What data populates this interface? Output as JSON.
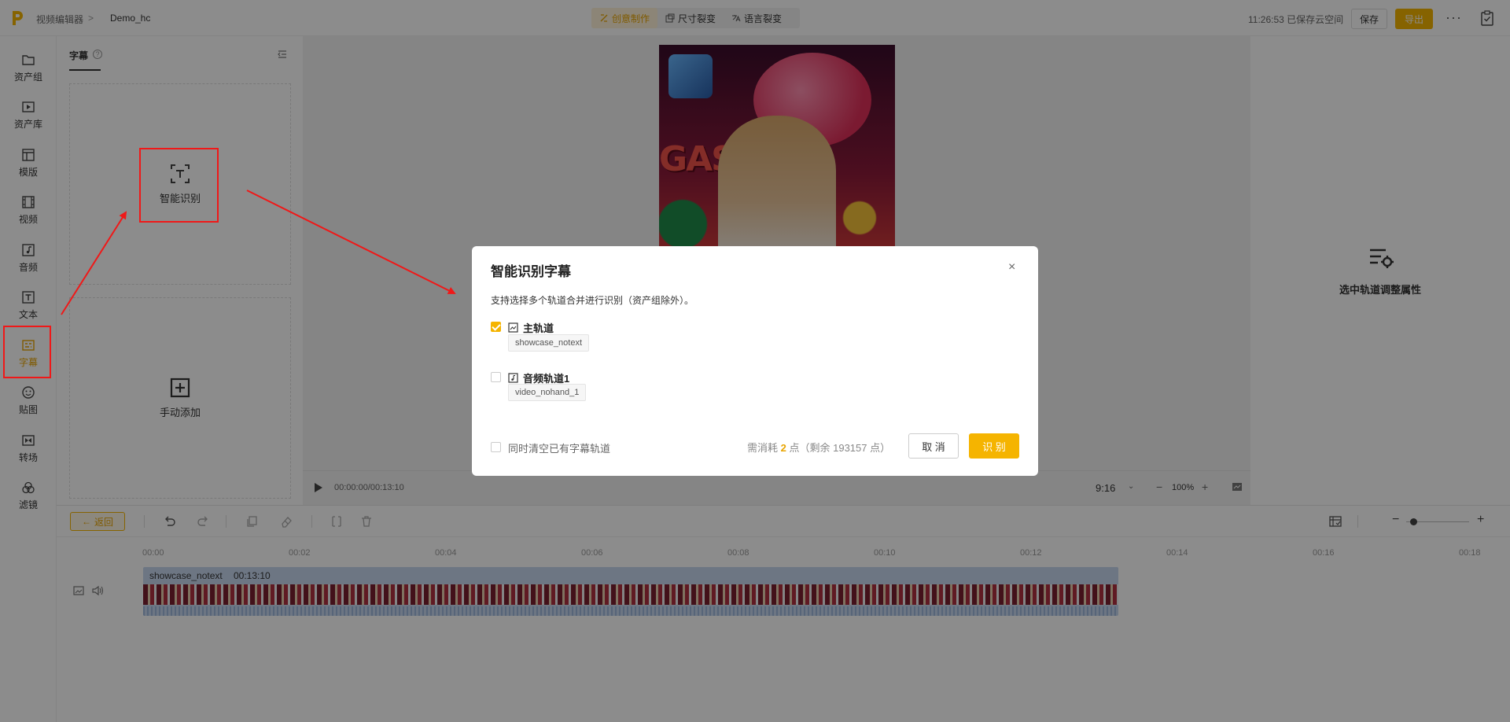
{
  "header": {
    "app_name": "视频编辑器",
    "breadcrumb_sep": ">",
    "project_name": "Demo_hc",
    "tabs": [
      {
        "label": "创意制作",
        "active": true
      },
      {
        "label": "尺寸裂变",
        "active": false
      },
      {
        "label": "语言裂变",
        "active": false
      }
    ],
    "save_status": "11:26:53 已保存云空间",
    "save_label": "保存",
    "export_label": "导出",
    "more_label": "···"
  },
  "sidebar": {
    "items": [
      {
        "label": "资产组",
        "icon": "folder-icon"
      },
      {
        "label": "资产库",
        "icon": "play-box-icon"
      },
      {
        "label": "模版",
        "icon": "template-icon"
      },
      {
        "label": "视频",
        "icon": "film-icon"
      },
      {
        "label": "音频",
        "icon": "music-icon"
      },
      {
        "label": "文本",
        "icon": "text-icon"
      },
      {
        "label": "字幕",
        "icon": "subtitle-icon",
        "active": true
      },
      {
        "label": "贴图",
        "icon": "sticker-icon"
      },
      {
        "label": "转场",
        "icon": "transition-icon"
      },
      {
        "label": "滤镜",
        "icon": "filter-icon"
      }
    ]
  },
  "panel": {
    "title": "字幕",
    "help": "?",
    "smart_label": "智能识别",
    "manual_label": "手动添加"
  },
  "player": {
    "timecode": "00:00:00/00:13:10",
    "ratio": "9:16",
    "zoom": "100%"
  },
  "props": {
    "hint": "选中轨道调整属性"
  },
  "timeline": {
    "back_label": "返回",
    "ticks": [
      "00:00",
      "00:02",
      "00:04",
      "00:06",
      "00:08",
      "00:10",
      "00:12",
      "00:14",
      "00:16",
      "00:18"
    ],
    "clip_name": "showcase_notext",
    "clip_duration": "00:13:10"
  },
  "modal": {
    "title": "智能识别字幕",
    "close": "×",
    "description": "支持选择多个轨道合并进行识别（资产组除外）。",
    "tracks": [
      {
        "label": "主轨道",
        "checked": true,
        "clip": "showcase_notext"
      },
      {
        "label": "音频轨道1",
        "checked": false,
        "clip": "video_nohand_1"
      }
    ],
    "clear_label": "同时清空已有字幕轨道",
    "cost_prefix": "需消耗",
    "cost_points": "2",
    "cost_suffix": "点（剩余 193157 点）",
    "cancel_label": "取 消",
    "confirm_label": "识 别"
  },
  "colors": {
    "accent": "#f5b400",
    "annotation": "#f01818",
    "overlay": "rgba(0,0,0,0.45)"
  }
}
